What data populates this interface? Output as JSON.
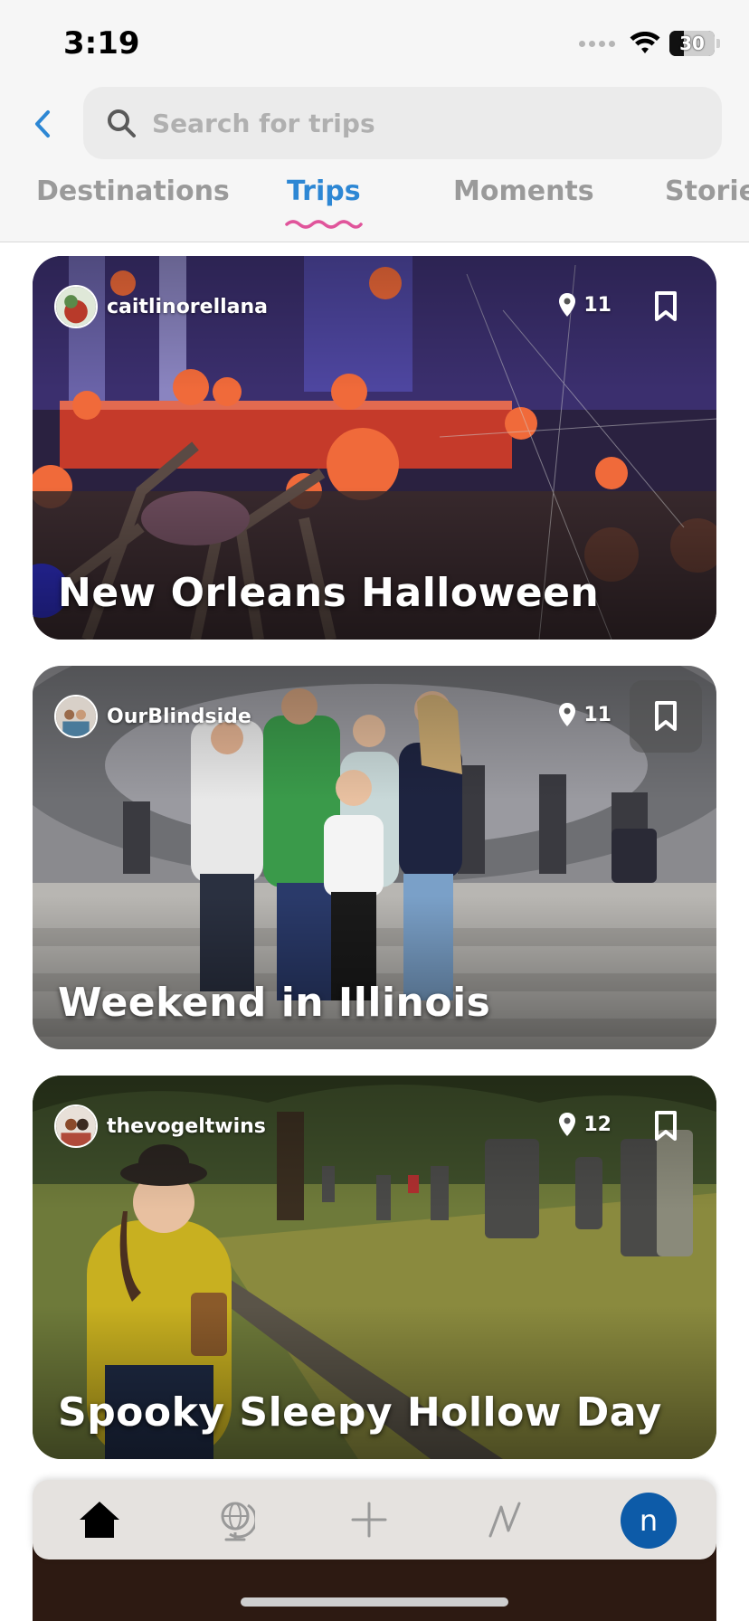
{
  "status_bar": {
    "time": "3:19",
    "battery": "30"
  },
  "header": {
    "search": {
      "placeholder": "Search for trips"
    },
    "tabs": [
      {
        "label": "Destinations",
        "active": false
      },
      {
        "label": "Trips",
        "active": true
      },
      {
        "label": "Moments",
        "active": false
      },
      {
        "label": "Storie",
        "active": false
      }
    ]
  },
  "trips": [
    {
      "author": "caitlinorellana",
      "stops": "11",
      "title": "New Orleans Halloween"
    },
    {
      "author": "OurBlindside",
      "stops": "11",
      "title": "Weekend in Illinois"
    },
    {
      "author": "thevogeltwins",
      "stops": "12",
      "title": "Spooky Sleepy Hollow Day"
    }
  ],
  "bottom_nav": {
    "items": [
      {
        "icon": "home-icon"
      },
      {
        "icon": "globe-icon"
      },
      {
        "icon": "plus-icon"
      },
      {
        "icon": "activity-icon"
      }
    ],
    "profile_initial": "n"
  },
  "colors": {
    "accent": "#2d87d4",
    "tab_underline": "#e0559b",
    "profile": "#0d5ba8"
  }
}
